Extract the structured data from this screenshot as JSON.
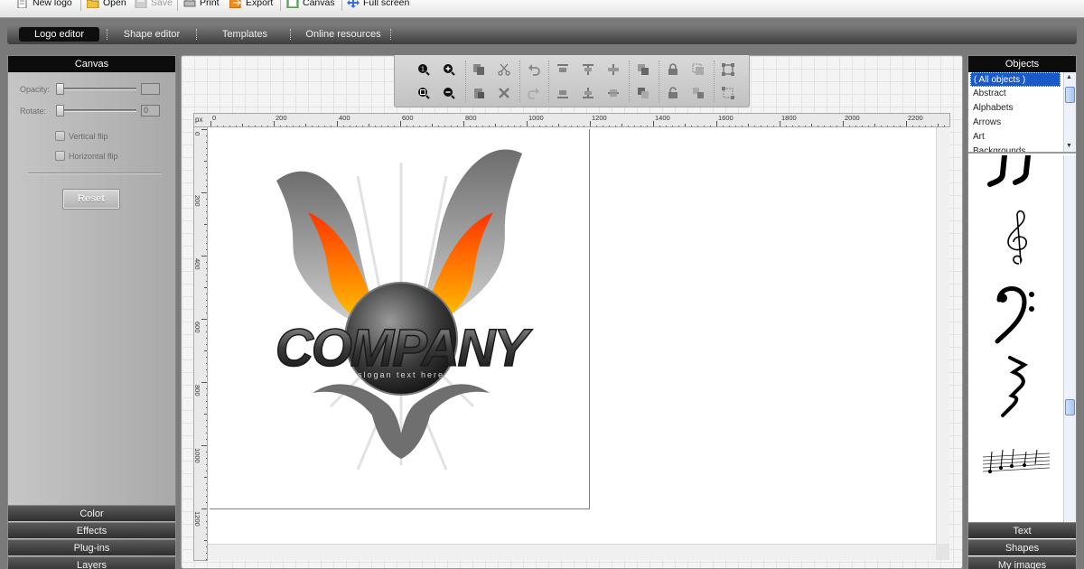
{
  "toolbar": {
    "items": [
      {
        "label": "New logo",
        "icon": "new-document-icon",
        "enabled": true
      },
      {
        "label": "Open",
        "icon": "folder-open-icon",
        "enabled": true
      },
      {
        "label": "Save",
        "icon": "save-disk-icon",
        "enabled": false
      },
      {
        "label": "Print",
        "icon": "printer-icon",
        "enabled": true
      },
      {
        "label": "Export",
        "icon": "export-icon",
        "enabled": true
      },
      {
        "label": "Canvas",
        "icon": "canvas-icon",
        "enabled": true
      },
      {
        "label": "Full screen",
        "icon": "fullscreen-icon",
        "enabled": true
      }
    ]
  },
  "tabs": {
    "items": [
      {
        "label": "Logo editor",
        "active": true
      },
      {
        "label": "Shape editor",
        "active": false
      },
      {
        "label": "Templates",
        "active": false
      },
      {
        "label": "Online resources",
        "active": false
      }
    ]
  },
  "left_panel": {
    "title": "Canvas",
    "opacity_label": "Opacity:",
    "opacity_value": "",
    "rotate_label": "Rotate:",
    "rotate_value": "0",
    "vertical_flip_label": "Vertical flip",
    "horizontal_flip_label": "Horizontal flip",
    "reset_label": "Reset",
    "sections": [
      "Color",
      "Effects",
      "Plug-ins",
      "Layers"
    ]
  },
  "edit_toolbar": {
    "icons": [
      "zoom-1-icon",
      "zoom-in-icon",
      "copy-icon",
      "cut-icon",
      "undo-icon",
      "align-top-icon",
      "align-center-icon",
      "align-right-icon",
      "bring-forward-icon",
      "lock-icon",
      "group-icon",
      "select-icon",
      "zoom-fit-icon",
      "zoom-out-icon",
      "paste-icon",
      "delete-icon",
      "redo-icon",
      "align-bottom-icon",
      "align-middle-icon",
      "distribute-icon",
      "send-backward-icon",
      "unlock-icon",
      "ungroup-icon",
      "deselect-icon"
    ]
  },
  "ruler": {
    "unit": "px",
    "top_labels": [
      "0",
      "200",
      "400",
      "600",
      "800",
      "1000",
      "1200",
      "1400",
      "1600",
      "1800",
      "2000",
      "2200"
    ],
    "left_labels": [
      "0",
      "200",
      "400",
      "600",
      "800",
      "1000",
      "1200"
    ]
  },
  "logo": {
    "text": "COMPANY",
    "slogan": "slogan text here",
    "colors": {
      "flame_outer": "#ff5a00",
      "flame_inner": "#ffcc00",
      "wing": "#9a9a9a",
      "badge": "#3a3a3a"
    }
  },
  "right_panel": {
    "title": "Objects",
    "objects": [
      "( All objects )",
      "Abstract",
      "Alphabets",
      "Arrows",
      "Art",
      "Backgrounds"
    ],
    "selected_index": 0,
    "shape_icons": [
      "music-note-shape-icon",
      "treble-clef-shape-icon",
      "bass-clef-shape-icon",
      "rest-shape-icon",
      "sheet-music-shape-icon"
    ],
    "sections": [
      "Text",
      "Shapes",
      "My images"
    ]
  },
  "colors": {
    "accent_selection": "#1a59c9",
    "panel_header": "#0c0c0c"
  }
}
